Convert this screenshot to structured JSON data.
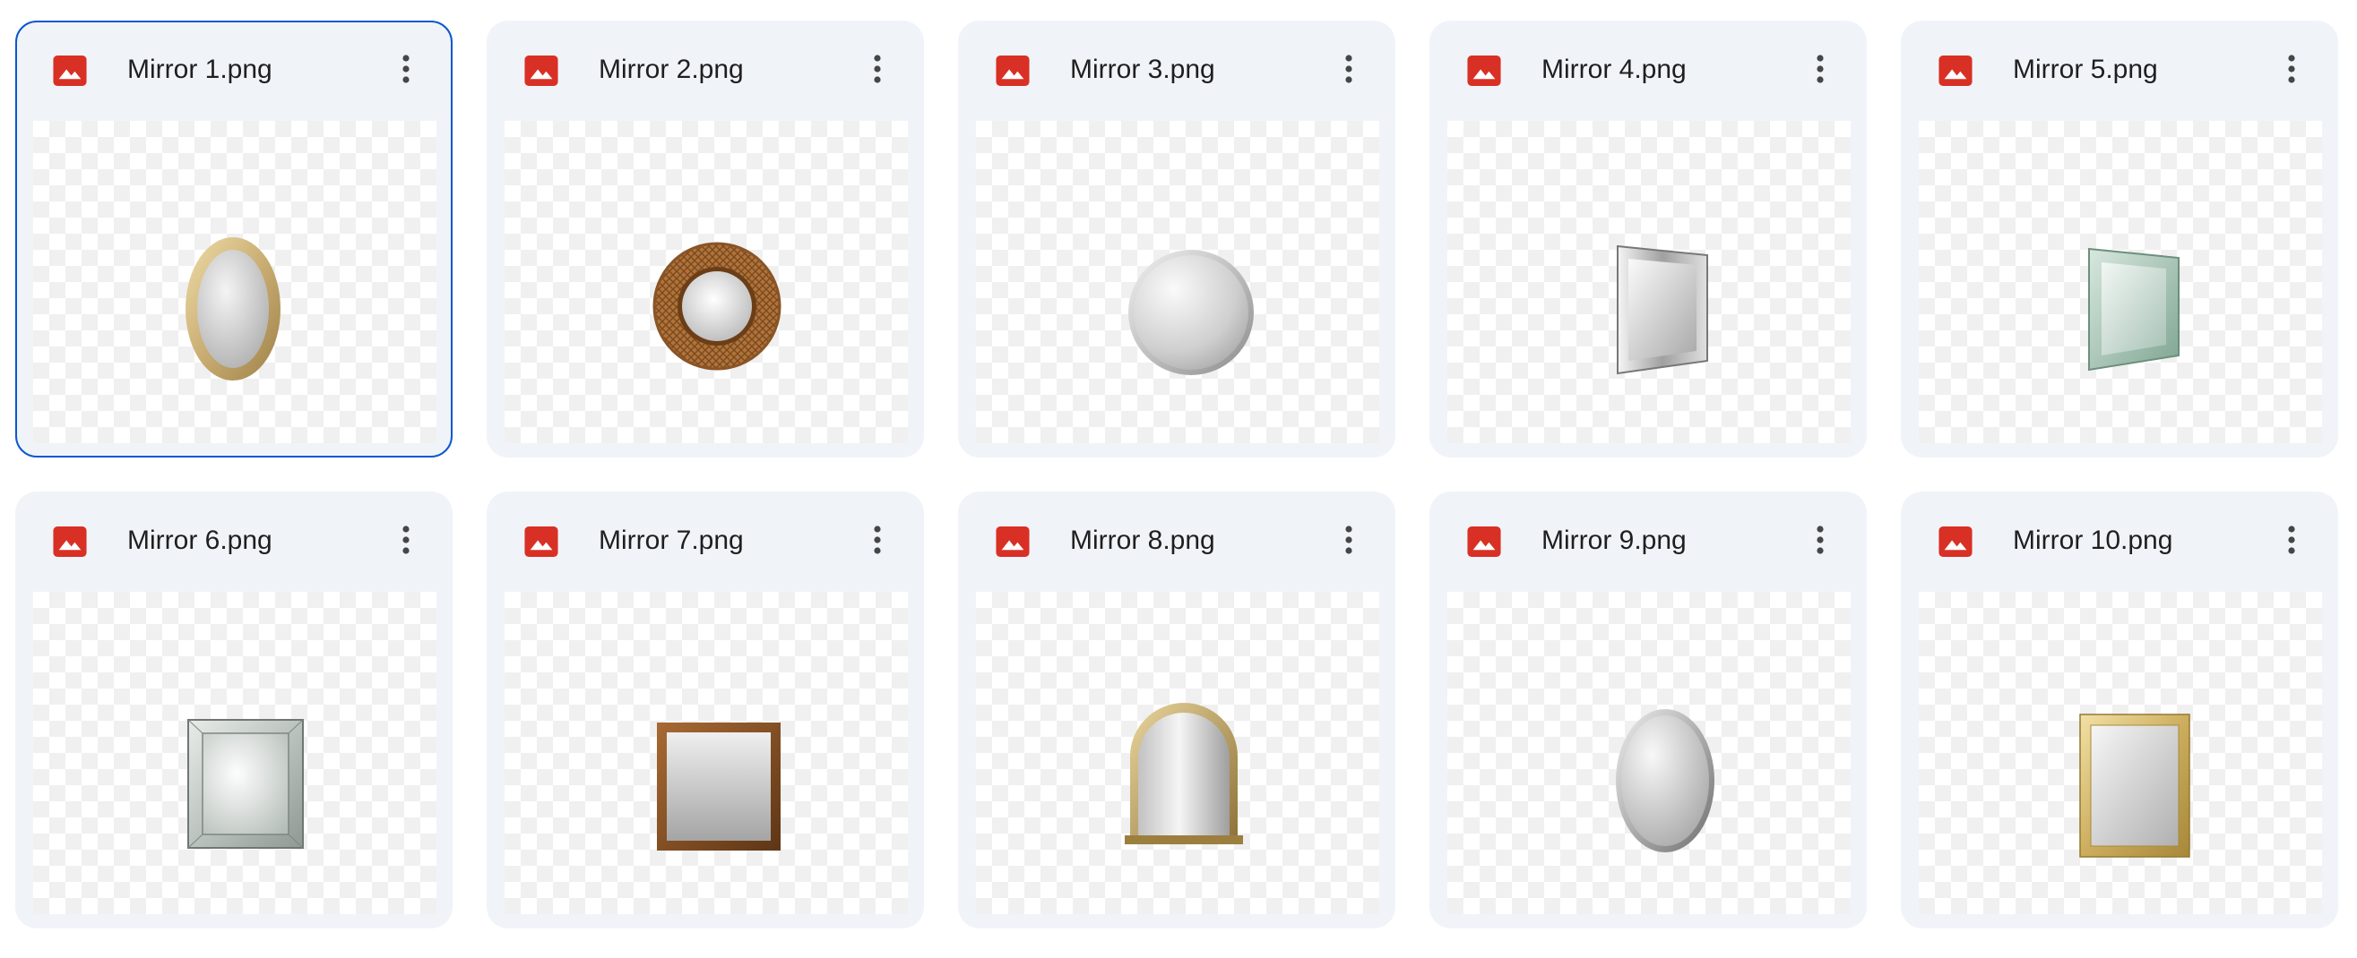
{
  "files": [
    {
      "name": "Mirror 1.png",
      "icon": "image-file-icon",
      "selected": true,
      "mirror": "gold-oval"
    },
    {
      "name": "Mirror 2.png",
      "icon": "image-file-icon",
      "selected": false,
      "mirror": "rattan-round"
    },
    {
      "name": "Mirror 3.png",
      "icon": "image-file-icon",
      "selected": false,
      "mirror": "silver-round"
    },
    {
      "name": "Mirror 4.png",
      "icon": "image-file-icon",
      "selected": false,
      "mirror": "silver-rectangle-angled"
    },
    {
      "name": "Mirror 5.png",
      "icon": "image-file-icon",
      "selected": false,
      "mirror": "green-glass-rectangle-angled"
    },
    {
      "name": "Mirror 6.png",
      "icon": "image-file-icon",
      "selected": false,
      "mirror": "venetian-square"
    },
    {
      "name": "Mirror 7.png",
      "icon": "image-file-icon",
      "selected": false,
      "mirror": "wood-square"
    },
    {
      "name": "Mirror 8.png",
      "icon": "image-file-icon",
      "selected": false,
      "mirror": "gold-arched"
    },
    {
      "name": "Mirror 9.png",
      "icon": "image-file-icon",
      "selected": false,
      "mirror": "silver-oval"
    },
    {
      "name": "Mirror 10.png",
      "icon": "image-file-icon",
      "selected": false,
      "mirror": "gold-rectangle"
    }
  ],
  "colors": {
    "card_background": "#f0f4f9",
    "selected_border": "#0b57d0",
    "file_icon_red": "#d93025",
    "text": "#1f1f1f",
    "more_icon": "#444746"
  }
}
